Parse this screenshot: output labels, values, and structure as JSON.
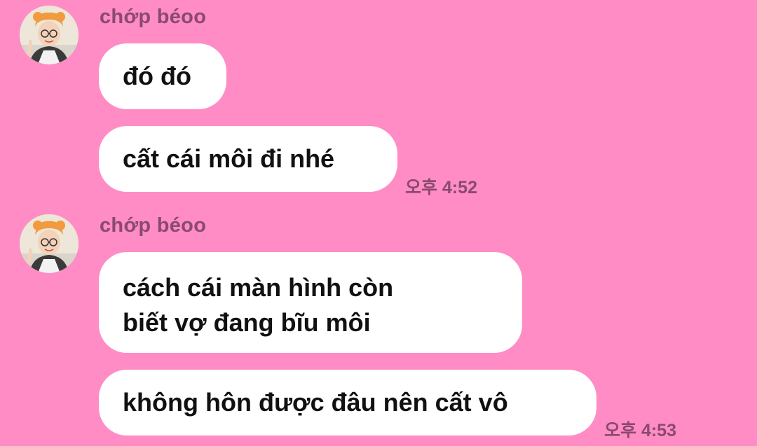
{
  "groups": [
    {
      "sender": "chớp béoo",
      "avatar_icon": "avatar-photo-icon",
      "messages": [
        {
          "lines": [
            "đó đó"
          ]
        },
        {
          "lines": [
            "cất cái môi đi nhé"
          ],
          "time": "오후 4:52"
        }
      ]
    },
    {
      "sender": "chớp béoo",
      "avatar_icon": "avatar-photo-icon",
      "messages": [
        {
          "lines": [
            "cách cái màn hình còn",
            "biết vợ đang bĩu môi"
          ]
        },
        {
          "lines": [
            "không hôn được đâu nên cất vô"
          ],
          "time": "오후 4:53"
        }
      ]
    }
  ],
  "colors": {
    "background": "#ff8cc5",
    "bubble": "#ffffff",
    "sender_text": "#8a4a6e",
    "message_text": "#111111"
  }
}
